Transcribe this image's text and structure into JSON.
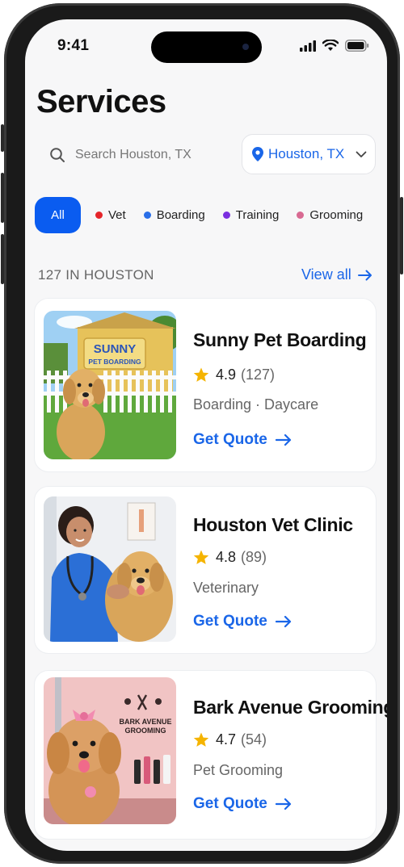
{
  "status": {
    "time": "9:41"
  },
  "page": {
    "title": "Services"
  },
  "search": {
    "placeholder": "Search Houston, TX"
  },
  "location": {
    "label": "Houston, TX"
  },
  "filters": {
    "all": "All",
    "items": [
      {
        "label": "Vet",
        "color": "#e5252a"
      },
      {
        "label": "Boarding",
        "color": "#2a6fe8"
      },
      {
        "label": "Training",
        "color": "#7b2fe0"
      },
      {
        "label": "Grooming",
        "color": "#d86a92"
      }
    ]
  },
  "results": {
    "count_label": "127 IN HOUSTON",
    "view_all": "View all"
  },
  "colors": {
    "accent": "#0a5cf0",
    "star": "#f5b400"
  },
  "listings": [
    {
      "name": "Sunny Pet Boarding",
      "rating": "4.9",
      "reviews": "(127)",
      "category": "Boarding · Daycare",
      "cta": "Get Quote",
      "sign": [
        "SUNNY",
        "PET BOARDING"
      ]
    },
    {
      "name": "Houston Vet Clinic",
      "rating": "4.8",
      "reviews": "(89)",
      "category": "Veterinary",
      "cta": "Get Quote"
    },
    {
      "name": "Bark Avenue Grooming",
      "rating": "4.7",
      "reviews": "(54)",
      "category": "Pet Grooming",
      "cta": "Get Quote",
      "sign": [
        "BARK AVENUE",
        "GROOMING"
      ]
    }
  ]
}
